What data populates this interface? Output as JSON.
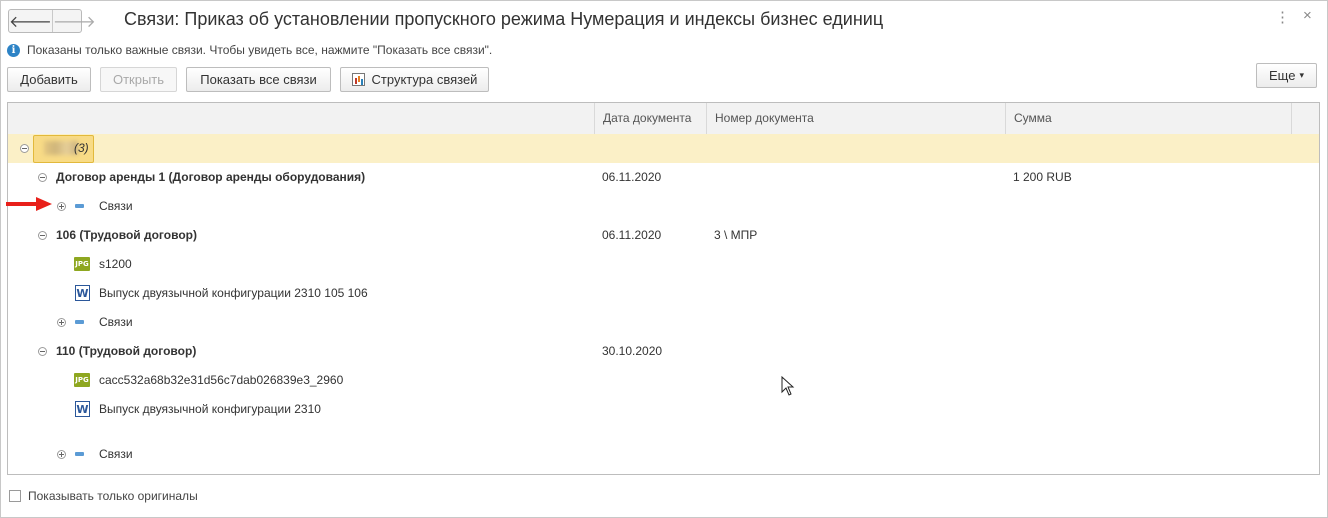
{
  "window": {
    "title": "Связи: Приказ об установлении пропускного режима  Нумерация и индексы бизнес единиц",
    "back_glyph": "🡐",
    "forward_glyph": "🡒",
    "menu_glyph": "⋮",
    "close_glyph": "×"
  },
  "info": {
    "icon_glyph": "i",
    "text": "Показаны только важные связи. Чтобы увидеть все, нажмите \"Показать все связи\"."
  },
  "toolbar": {
    "add_label": "Добавить",
    "open_label": "Открыть",
    "show_all_label": "Показать все связи",
    "structure_label": "Структура связей",
    "more_label": "Еще",
    "more_caret": "▾"
  },
  "table": {
    "columns": [
      "Дата документа",
      "Номер документа",
      "Сумма"
    ],
    "group": {
      "count_label": "(3)"
    },
    "rows": [
      {
        "label": "Договор аренды 1 (Договор аренды оборудования)",
        "date": "06.11.2020",
        "number": "",
        "sum": "1 200 RUB"
      },
      {
        "label": "Связи"
      },
      {
        "label": "106 (Трудовой договор)",
        "date": "06.11.2020",
        "number": "3 \\ МПР",
        "sum": ""
      },
      {
        "label": "s1200"
      },
      {
        "label": "Выпуск двуязычной конфигурации 2310 105 106"
      },
      {
        "label": "Связи"
      },
      {
        "label": "110 (Трудовой договор)",
        "date": "30.10.2020",
        "number": "",
        "sum": ""
      },
      {
        "label": "cacc532a68b32e31d56c7dab026839e3_2960"
      },
      {
        "label": "Выпуск двуязычной конфигурации 2310"
      },
      {
        "label": "Связи"
      }
    ],
    "jpg_icon_text": "JPG",
    "word_icon_text": "W"
  },
  "footer": {
    "originals_label": "Показывать только оригиналы",
    "originals_checked": false
  },
  "colors": {
    "group_row_bg": "#fbf0c7",
    "group_cell_bg": "#f8db86",
    "info_icon": "#2d83c6",
    "arrow": "#e8201a"
  }
}
